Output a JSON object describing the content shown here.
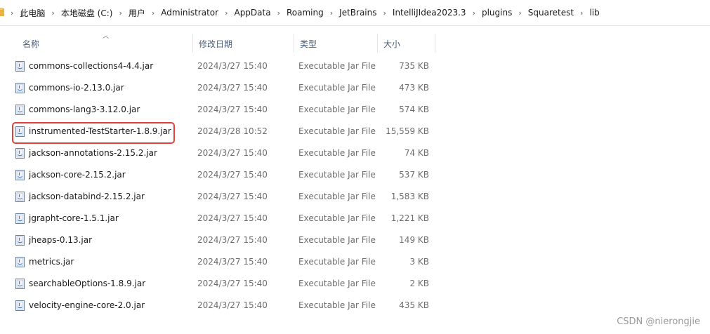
{
  "breadcrumb": [
    "此电脑",
    "本地磁盘 (C:)",
    "用户",
    "Administrator",
    "AppData",
    "Roaming",
    "JetBrains",
    "IntelliJIdea2023.3",
    "plugins",
    "Squaretest",
    "lib"
  ],
  "columns": {
    "name": "名称",
    "date": "修改日期",
    "type": "类型",
    "size": "大小"
  },
  "files": [
    {
      "name": "commons-collections4-4.4.jar",
      "date": "2024/3/27 15:40",
      "type": "Executable Jar File",
      "size": "735 KB"
    },
    {
      "name": "commons-io-2.13.0.jar",
      "date": "2024/3/27 15:40",
      "type": "Executable Jar File",
      "size": "473 KB"
    },
    {
      "name": "commons-lang3-3.12.0.jar",
      "date": "2024/3/27 15:40",
      "type": "Executable Jar File",
      "size": "574 KB"
    },
    {
      "name": "instrumented-TestStarter-1.8.9.jar",
      "date": "2024/3/28 10:52",
      "type": "Executable Jar File",
      "size": "15,559 KB"
    },
    {
      "name": "jackson-annotations-2.15.2.jar",
      "date": "2024/3/27 15:40",
      "type": "Executable Jar File",
      "size": "74 KB"
    },
    {
      "name": "jackson-core-2.15.2.jar",
      "date": "2024/3/27 15:40",
      "type": "Executable Jar File",
      "size": "537 KB"
    },
    {
      "name": "jackson-databind-2.15.2.jar",
      "date": "2024/3/27 15:40",
      "type": "Executable Jar File",
      "size": "1,583 KB"
    },
    {
      "name": "jgrapht-core-1.5.1.jar",
      "date": "2024/3/27 15:40",
      "type": "Executable Jar File",
      "size": "1,221 KB"
    },
    {
      "name": "jheaps-0.13.jar",
      "date": "2024/3/27 15:40",
      "type": "Executable Jar File",
      "size": "149 KB"
    },
    {
      "name": "metrics.jar",
      "date": "2024/3/27 15:40",
      "type": "Executable Jar File",
      "size": "3 KB"
    },
    {
      "name": "searchableOptions-1.8.9.jar",
      "date": "2024/3/27 15:40",
      "type": "Executable Jar File",
      "size": "2 KB"
    },
    {
      "name": "velocity-engine-core-2.0.jar",
      "date": "2024/3/27 15:40",
      "type": "Executable Jar File",
      "size": "435 KB"
    }
  ],
  "watermark": "CSDN @nierongjie",
  "icons": {
    "folder": "folder-icon",
    "file": "jar-file-icon",
    "sort": "sort-ascending-icon"
  },
  "colors": {
    "highlight": "#e0413a",
    "header_text": "#4c607a"
  }
}
